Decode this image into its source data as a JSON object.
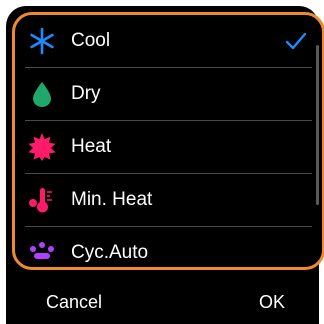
{
  "modes": [
    {
      "label": "Cool",
      "icon": "snowflake-icon",
      "color": "#1a8cff",
      "selected": true
    },
    {
      "label": "Dry",
      "icon": "droplet-icon",
      "color": "#1fa86a",
      "selected": false
    },
    {
      "label": "Heat",
      "icon": "sun-icon",
      "color": "#ff1a6a",
      "selected": false
    },
    {
      "label": "Min. Heat",
      "icon": "thermometer-icon",
      "color": "#ff1a6a",
      "selected": false
    },
    {
      "label": "Cyc.Auto",
      "icon": "auto-icon",
      "color": "#b040ff",
      "selected": false
    }
  ],
  "buttons": {
    "cancel": "Cancel",
    "ok": "OK"
  },
  "colors": {
    "accent": "#f08a2e",
    "check": "#1a8cff",
    "background": "#000000"
  }
}
